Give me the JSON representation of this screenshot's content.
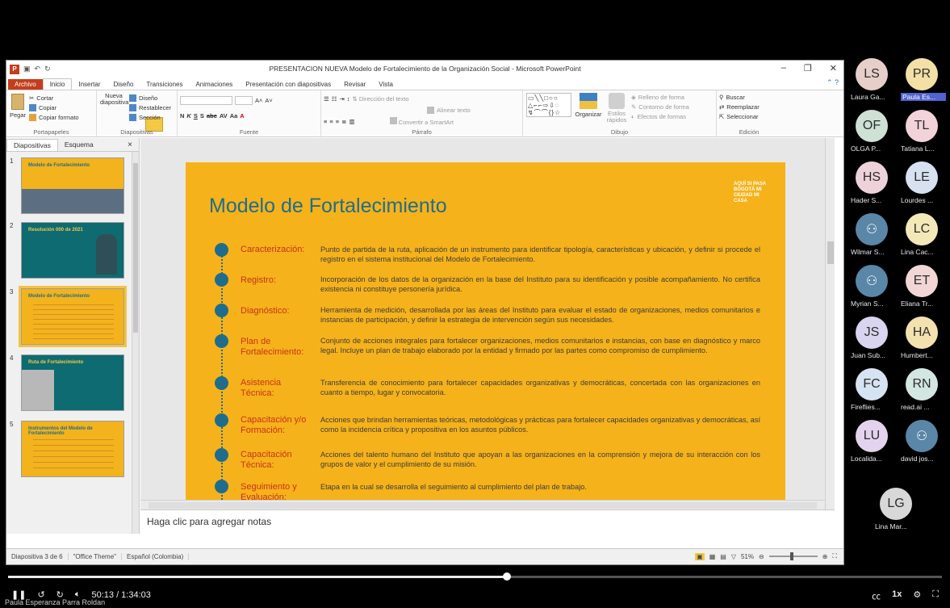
{
  "window": {
    "title": "PRESENTACION NUEVA Modelo de Fortalecimiento de la Organización Social - Microsoft PowerPoint",
    "app_letter": "P"
  },
  "tabs": [
    "Archivo",
    "Inicio",
    "Insertar",
    "Diseño",
    "Transiciones",
    "Animaciones",
    "Presentación con diapositivas",
    "Revisar",
    "Vista"
  ],
  "ribbon": {
    "portapapeles": {
      "label": "Portapapeles",
      "pegar": "Pegar",
      "cortar": "Cortar",
      "copiar": "Copiar",
      "copiar_formato": "Copiar formato"
    },
    "diapositivas": {
      "label": "Diapositivas",
      "nueva": "Nueva diapositiva",
      "diseno": "Diseño",
      "restablecer": "Restablecer",
      "seccion": "Sección"
    },
    "fuente": {
      "label": "Fuente"
    },
    "parrafo": {
      "label": "Párrafo",
      "direccion": "Dirección del texto",
      "alinear": "Alinear texto",
      "convertir": "Convertir a SmartArt"
    },
    "dibujo": {
      "label": "Dibujo",
      "organizar": "Organizar",
      "estilos": "Estilos rápidos",
      "relleno": "Relleno de forma",
      "contorno": "Contorno de forma",
      "efectos": "Efectos de formas"
    },
    "edicion": {
      "label": "Edición",
      "buscar": "Buscar",
      "reemplazar": "Reemplazar",
      "seleccionar": "Seleccionar"
    }
  },
  "panel": {
    "tab_diapositivas": "Diapositivas",
    "tab_esquema": "Esquema",
    "close": "×"
  },
  "thumbnails": [
    {
      "num": "1",
      "title": "Modelo de Fortalecimiento"
    },
    {
      "num": "2",
      "title": "Resolución 000 de 2021"
    },
    {
      "num": "3",
      "title": "Modelo de Fortalecimiento"
    },
    {
      "num": "4",
      "title": "Ruta de Fortalecimiento"
    },
    {
      "num": "5",
      "title": "Instrumentos del Modelo de Fortalecimiento"
    }
  ],
  "slide": {
    "title": "Modelo de Fortalecimiento",
    "logo": "AQUÍ SI PASA BOGOTÁ MI CIUDAD MI CASA",
    "items": [
      {
        "term": "Caracterización:",
        "def": "Punto de partida de la ruta, aplicación de un instrumento para identificar tipología, características y ubicación, y definir si procede el registro en el sistema institucional del Modelo de Fortalecimiento."
      },
      {
        "term": "Registro:",
        "def": "Incorporación de los datos de la organización en la base del Instituto para su identificación y posible acompañamiento. No certifica existencia ni constituye personería jurídica."
      },
      {
        "term": "Diagnóstico:",
        "def": "Herramienta de medición, desarrollada por las áreas del Instituto para evaluar el estado de organizaciones, medios comunitarios e instancias de participación, y definir la estrategia de intervención según sus necesidades."
      },
      {
        "term": "Plan de Fortalecimiento:",
        "def": "Conjunto de acciones integrales para fortalecer organizaciones, medios comunitarios e instancias, con base en diagnóstico y marco legal. Incluye un plan de trabajo elaborado por la entidad y firmado por las partes como compromiso de cumplimiento."
      },
      {
        "term": "Asistencia Técnica:",
        "def": "Transferencia de conocimiento para fortalecer capacidades organizativas y democráticas, concertada con las organizaciones en cuanto a tiempo, lugar y convocatoria."
      },
      {
        "term": "Capacitación y/o Formación:",
        "def": "Acciones que brindan herramientas teóricas, metodológicas y prácticas para fortalecer capacidades organizativas y democráticas, así como la incidencia crítica y propositiva en los asuntos públicos."
      },
      {
        "term": "Capacitación Técnica:",
        "def": "Acciones del talento humano del Instituto que apoyan a las organizaciones en la comprensión y mejora de su interacción con los grupos de valor y el cumplimiento de su misión."
      },
      {
        "term": "Seguimiento y Evaluación:",
        "def": "Etapa en la cual se desarrolla el seguimiento al cumplimiento del plan de trabajo."
      }
    ]
  },
  "notes": {
    "placeholder": "Haga clic para agregar notas"
  },
  "status": {
    "slide": "Diapositiva 3 de 6",
    "theme": "\"Office Theme\"",
    "lang": "Español (Colombia)",
    "zoom": "51%"
  },
  "participants": [
    {
      "initials": "LS",
      "name": "Laura Ga...",
      "color": "#e6cfc8"
    },
    {
      "initials": "PR",
      "name": "Paula Es...",
      "color": "#f3e0a6",
      "highlight": true
    },
    {
      "initials": "OF",
      "name": "OLGA P...",
      "color": "#cfe0d5"
    },
    {
      "initials": "TL",
      "name": "Tatiana L...",
      "color": "#f1d3d9"
    },
    {
      "initials": "HS",
      "name": "Hader S...",
      "color": "#eed2da"
    },
    {
      "initials": "LE",
      "name": "Lourdes ...",
      "color": "#d7e1f0"
    },
    {
      "initials": "",
      "name": "Wilmar S...",
      "color": "#5a86a8",
      "person": true
    },
    {
      "initials": "LC",
      "name": "Lina Cac...",
      "color": "#f3e8b8"
    },
    {
      "initials": "",
      "name": "Myrian S...",
      "color": "#5a86a8",
      "person": true
    },
    {
      "initials": "ET",
      "name": "Eliana Tr...",
      "color": "#f2d6d6"
    },
    {
      "initials": "JS",
      "name": "Juan Sub...",
      "color": "#d9d4ef"
    },
    {
      "initials": "HA",
      "name": "Humbert...",
      "color": "#f3e2b0"
    },
    {
      "initials": "FC",
      "name": "Fireflies...",
      "color": "#d6e3f2"
    },
    {
      "initials": "RN",
      "name": "read.ai ...",
      "color": "#d4e6e2"
    },
    {
      "initials": "LU",
      "name": "Localida...",
      "color": "#e4d3ee"
    },
    {
      "initials": "",
      "name": "david jos...",
      "color": "#5a86a8",
      "person": true
    },
    {
      "initials": "LG",
      "name": "Lina Mar...",
      "color": "#d8d8d8"
    }
  ],
  "player": {
    "time": "50:13 / 1:34:03",
    "speed": "1x",
    "speaker": "Paula Esperanza Parra Roldan",
    "progress": 0.534
  }
}
